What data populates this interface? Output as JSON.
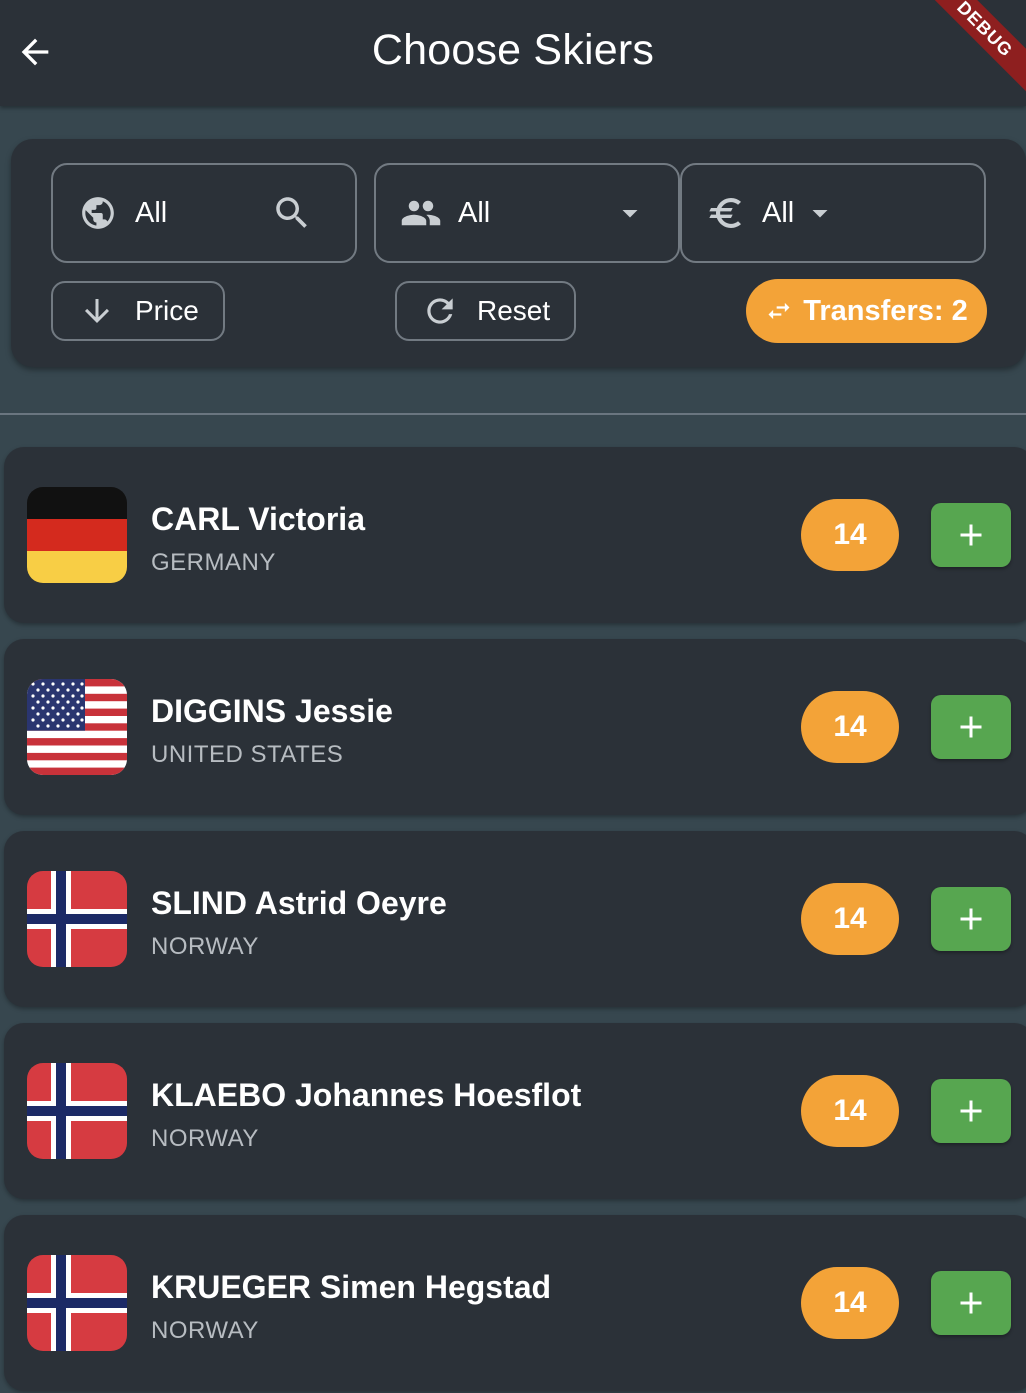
{
  "appbar": {
    "title": "Choose Skiers",
    "debug_label": "DEBUG"
  },
  "filters": {
    "country": {
      "value": "All",
      "icon": "globe-icon",
      "search_icon": "search-icon"
    },
    "gender": {
      "value": "All",
      "icon": "people-icon"
    },
    "price": {
      "value": "All",
      "icon": "euro-icon"
    },
    "sort_label": "Price",
    "reset_label": "Reset",
    "transfers_label": "Transfers: 2"
  },
  "colors": {
    "accent_orange": "#f3a338",
    "add_green": "#57a650",
    "card_bg": "#2b3138",
    "page_bg": "#37474f"
  },
  "skiers": [
    {
      "name": "CARL Victoria",
      "country": "GERMANY",
      "price": "14",
      "flag": "germany-flag"
    },
    {
      "name": "DIGGINS Jessie",
      "country": "UNITED STATES",
      "price": "14",
      "flag": "usa-flag"
    },
    {
      "name": "SLIND Astrid Oeyre",
      "country": "NORWAY",
      "price": "14",
      "flag": "norway-flag"
    },
    {
      "name": "KLAEBO Johannes Hoesflot",
      "country": "NORWAY",
      "price": "14",
      "flag": "norway-flag"
    },
    {
      "name": "KRUEGER Simen Hegstad",
      "country": "NORWAY",
      "price": "14",
      "flag": "norway-flag"
    }
  ]
}
